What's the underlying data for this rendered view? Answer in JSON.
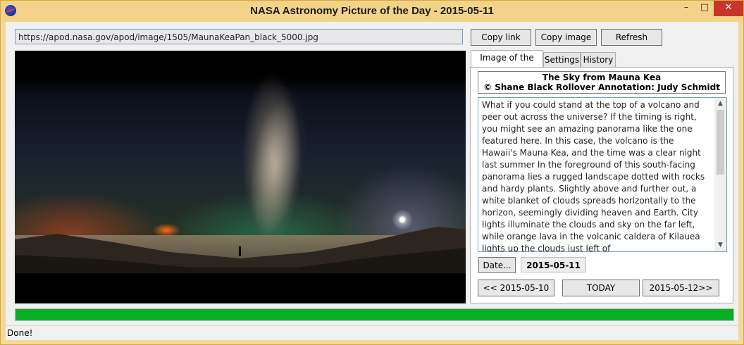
{
  "window": {
    "title": "NASA Astronomy Picture of the Day - 2015-05-11",
    "minimize_glyph": "–",
    "maximize_glyph": "□",
    "close_glyph": "✕"
  },
  "toolbar": {
    "url_value": "https://apod.nasa.gov/apod/image/1505/MaunaKeaPan_black_5000.jpg",
    "copy_link_label": "Copy link",
    "copy_image_label": "Copy image",
    "refresh_label": "Refresh"
  },
  "tabs": {
    "image_of_day": "Image of the day",
    "settings": "Settings",
    "history": "History"
  },
  "apod": {
    "title_line1": "The Sky from Mauna Kea",
    "title_line2": "© Shane Black Rollover Annotation: Judy Schmidt",
    "description": "What if you could stand at the top of a volcano and peer out across the universe? If the timing is right, you might see an amazing panorama like the one featured here. In this case, the volcano is the Hawaii's Mauna Kea, and the time was a clear night last summer In the foreground of this south-facing panorama lies a rugged landscape dotted with rocks and hardy plants. Slightly above and further out, a white blanket of clouds spreads horizontally to the horizon, seemingly dividing heaven and Earth.  City lights illuminate the clouds and sky on the far left, while orange lava in the volcanic caldera of Kilauea lights up the clouds just left of"
  },
  "navigation": {
    "date_button_label": "Date...",
    "current_date": "2015-05-11",
    "prev_label": "<< 2015-05-10",
    "today_label": "TODAY",
    "next_label": "2015-05-12>>"
  },
  "progress": {
    "percent": 100,
    "color": "#06b025"
  },
  "status": {
    "text": "Done!"
  },
  "icons": {
    "app": "nasa-logo-icon",
    "scroll_up": "▲",
    "scroll_down": "▼"
  }
}
